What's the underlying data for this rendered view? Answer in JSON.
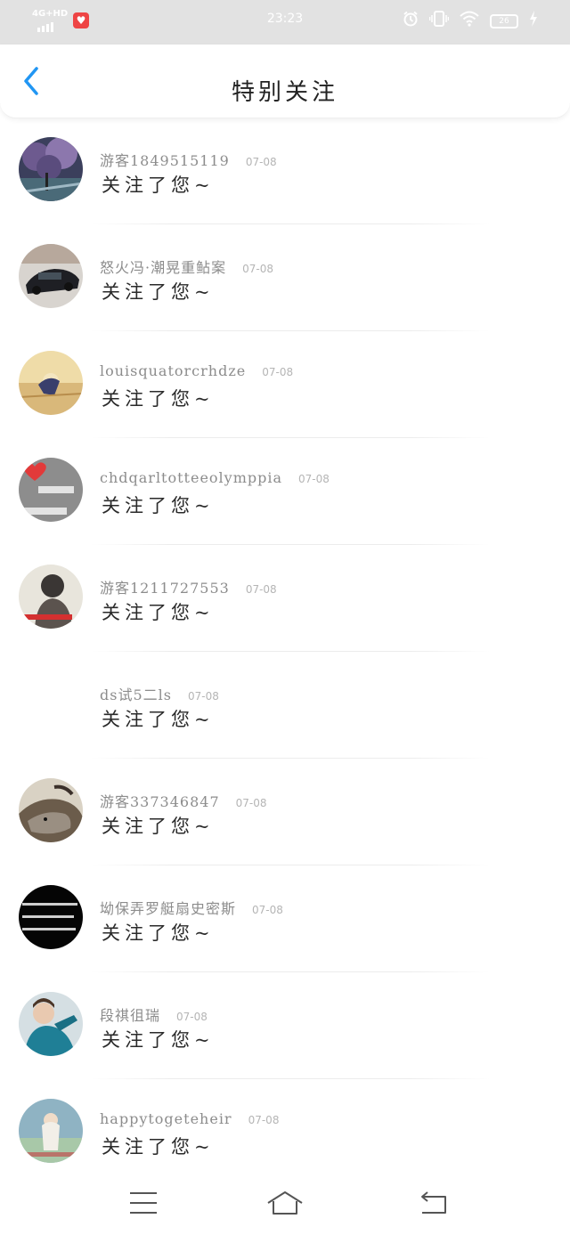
{
  "status_bar": {
    "network": "4G+HD",
    "time": "23:23",
    "battery": "26",
    "icons": [
      "signal-icon",
      "app-badge-icon",
      "alarm-icon",
      "vibrate-icon",
      "wifi-icon",
      "battery-icon",
      "charging-icon"
    ]
  },
  "header": {
    "title": "特别关注",
    "back_icon": "chevron-left-icon",
    "accent_color": "#2196f3"
  },
  "list": {
    "items": [
      {
        "name": "游客1849515119",
        "date": "07-08",
        "message": "关注了您~",
        "avatar": "avatar-purple-trees"
      },
      {
        "name": "怒火冯·潮晃重鲇案",
        "date": "07-08",
        "message": "关注了您~",
        "avatar": "avatar-black-car"
      },
      {
        "name": "louisquatorcrhdze",
        "date": "07-08",
        "message": "关注了您~",
        "avatar": "avatar-sunset-figure"
      },
      {
        "name": "chdqarltotteeolymppia",
        "date": "07-08",
        "message": "关注了您~",
        "avatar": "avatar-pink-heart"
      },
      {
        "name": "游客1211727553",
        "date": "07-08",
        "message": "关注了您~",
        "avatar": "avatar-hooded-girl"
      },
      {
        "name": "ds试5二ls",
        "date": "07-08",
        "message": "关注了您~",
        "avatar": "avatar-blank"
      },
      {
        "name": "游客337346847",
        "date": "07-08",
        "message": "关注了您~",
        "avatar": "avatar-wolf"
      },
      {
        "name": "坳保弄罗艇扇史密斯",
        "date": "07-08",
        "message": "关注了您~",
        "avatar": "avatar-black-text"
      },
      {
        "name": "段祺徂瑞",
        "date": "07-08",
        "message": "关注了您~",
        "avatar": "avatar-teal-boy"
      },
      {
        "name": "happytogeteheir",
        "date": "07-08",
        "message": "关注了您~",
        "avatar": "avatar-blue-girl"
      }
    ]
  },
  "nav_bar": {
    "icons": [
      "menu-icon",
      "home-icon",
      "back-icon"
    ]
  }
}
